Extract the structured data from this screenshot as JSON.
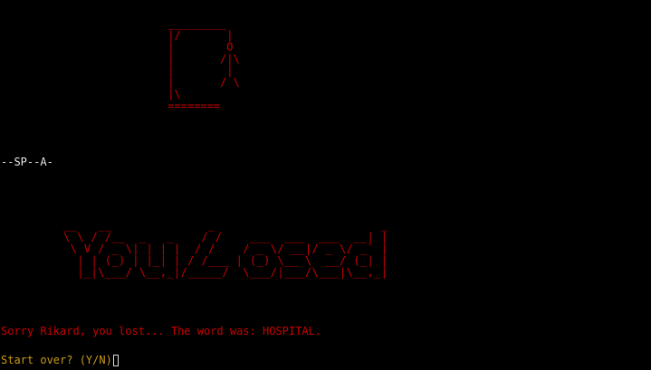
{
  "colors": {
    "background": "#000000",
    "hangman_red": "#cc0000",
    "progress_text": "#e8e8e8",
    "prompt_amber": "#c89a1a"
  },
  "gallows_art": " _________\n |/       |\n |        O\n |       /|\\\n |        |\n |       / \\\n |\\\n ========",
  "word_progress": "--SP--A-",
  "banner_art": "__   __              _                        _ \n\\ \\ / /__  _   _    / /    ___  ___  ___  __| |\n \\ V / _ \\| | | |  / /    / _ \\/ __|/ _ \\/ _` |\n  | | (_) | |_| | / /___ | (_) \\__ \\  __/ (_| |\n  |_|\\___/ \\__,_|/_____/  \\___/|___/\\___|\\__,_|",
  "result_message": "Sorry Rikard, you lost... The word was: HOSPITAL.",
  "prompt_text": "Start over? (Y/N)"
}
